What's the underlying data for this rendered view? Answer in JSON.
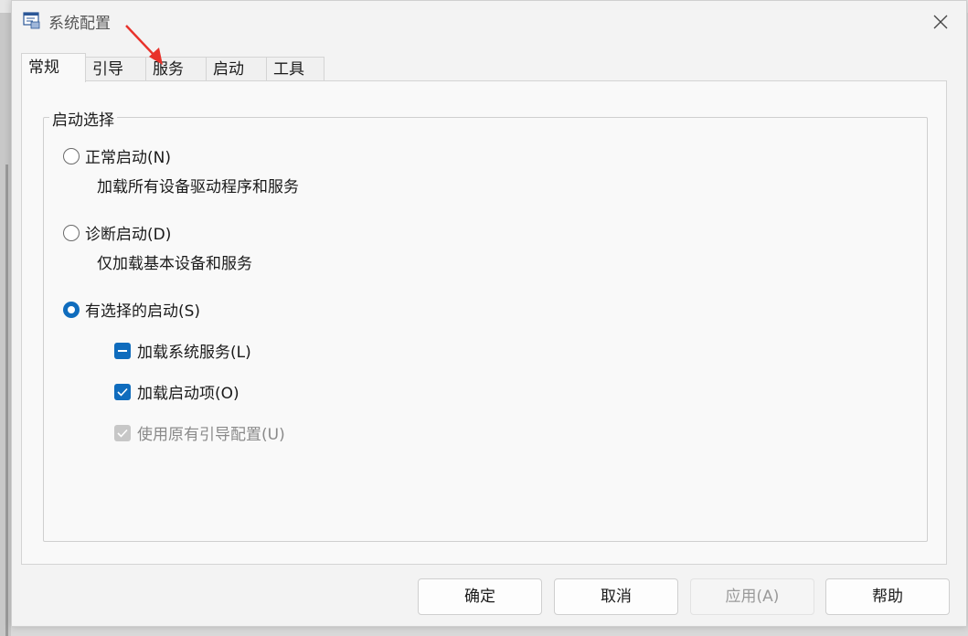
{
  "window": {
    "title": "系统配置"
  },
  "tabs": [
    "常规",
    "引导",
    "服务",
    "启动",
    "工具"
  ],
  "startup_selection": {
    "legend": "启动选择",
    "normal": {
      "label": "正常启动(N)",
      "desc": "加载所有设备驱动程序和服务",
      "checked": false
    },
    "diagnostic": {
      "label": "诊断启动(D)",
      "desc": "仅加载基本设备和服务",
      "checked": false
    },
    "selective": {
      "label": "有选择的启动(S)",
      "checked": true
    },
    "options": [
      {
        "label": "加载系统服务(L)",
        "state": "indeterminate"
      },
      {
        "label": "加载启动项(O)",
        "state": "checked"
      },
      {
        "label": "使用原有引导配置(U)",
        "state": "checked-disabled"
      }
    ]
  },
  "buttons": {
    "ok": "确定",
    "cancel": "取消",
    "apply": "应用(A)",
    "help": "帮助"
  },
  "colors": {
    "accent": "#0f6cbd",
    "annotation_arrow": "#e8322b"
  },
  "icons": {
    "app": "msconfig-icon",
    "close": "close-icon"
  }
}
